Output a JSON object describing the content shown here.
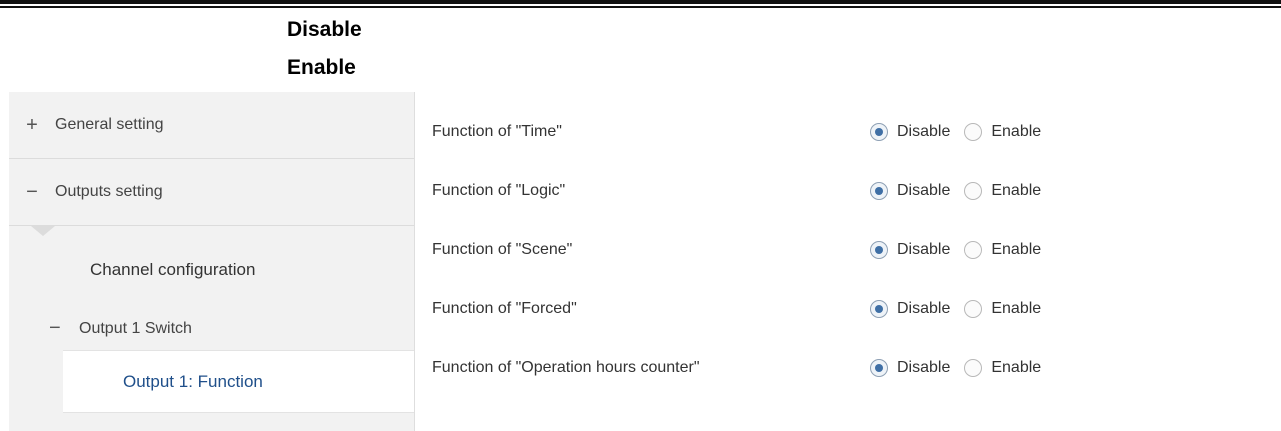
{
  "legend": {
    "disable": "Disable",
    "enable": "Enable"
  },
  "sidebar": {
    "general": {
      "sign": "+",
      "label": "General setting"
    },
    "outputs": {
      "sign": "−",
      "label": "Outputs setting"
    },
    "channel_config": "Channel configuration",
    "output_switch": {
      "sign": "−",
      "label": "Output 1 Switch"
    },
    "output_function": "Output 1: Function"
  },
  "params": [
    {
      "label": "Function of \"Time\"",
      "selected": "Disable"
    },
    {
      "label": "Function of \"Logic\"",
      "selected": "Disable"
    },
    {
      "label": "Function of \"Scene\"",
      "selected": "Disable"
    },
    {
      "label": "Function of \"Forced\"",
      "selected": "Disable"
    },
    {
      "label": "Function of \"Operation hours counter\"",
      "selected": "Disable"
    }
  ],
  "options": {
    "disable": "Disable",
    "enable": "Enable"
  },
  "colors": {
    "selected_text": "#1f4f8a",
    "radio_dot": "#3f6fa5"
  }
}
